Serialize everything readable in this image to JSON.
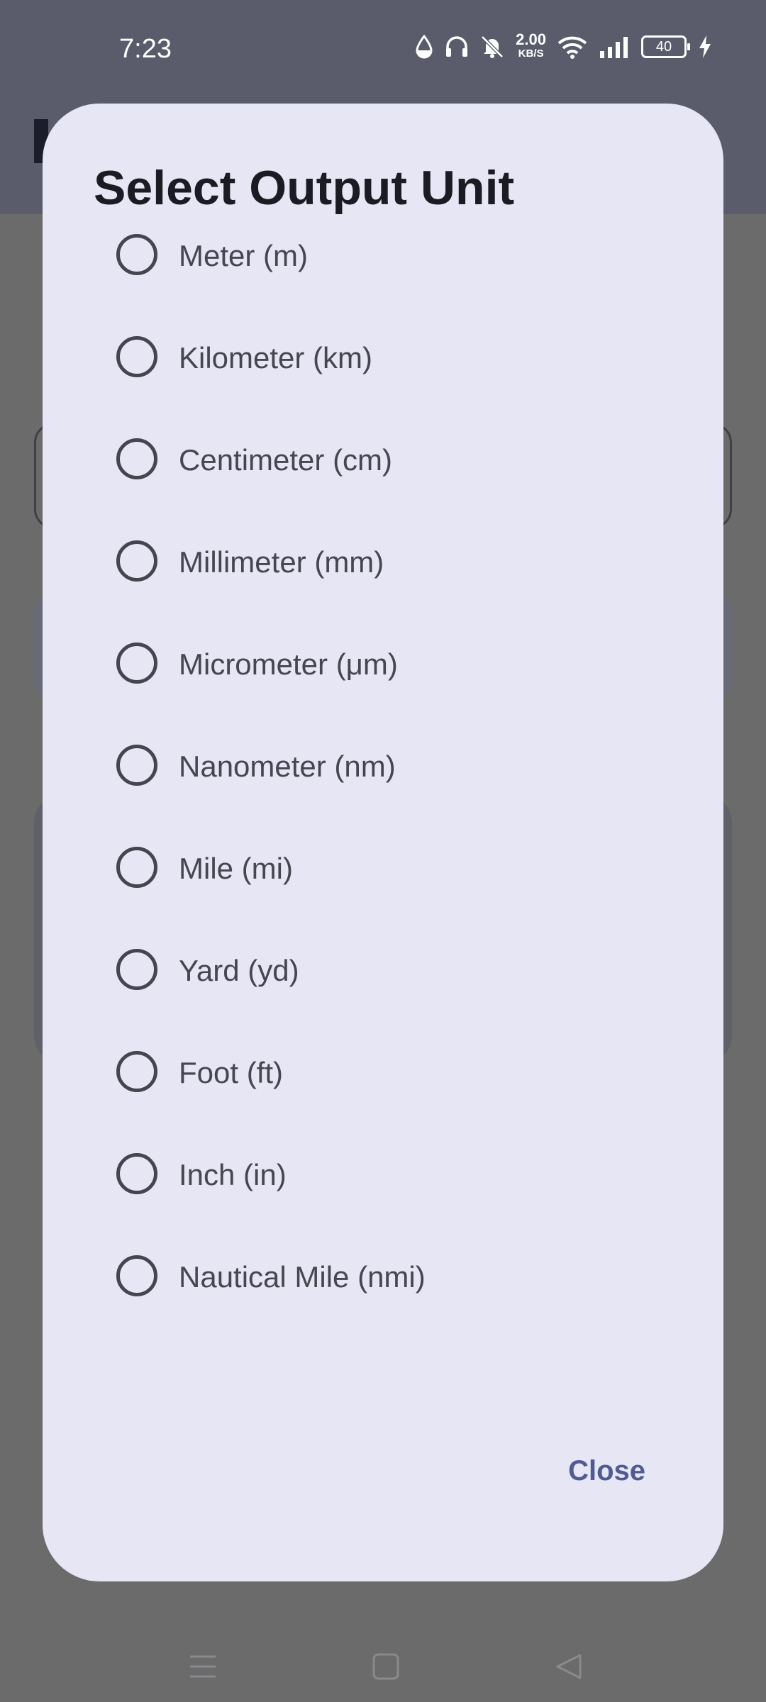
{
  "status_bar": {
    "time": "7:23",
    "net_speed_value": "2.00",
    "net_speed_unit": "KB/S",
    "battery": "40",
    "icons": [
      "drop-icon",
      "headphones-icon",
      "bell-off-icon",
      "wifi-icon",
      "signal-icon",
      "battery-icon",
      "charging-icon"
    ]
  },
  "dialog": {
    "title": "Select Output Unit",
    "options": [
      {
        "label": "Meter (m)",
        "selected": false
      },
      {
        "label": "Kilometer (km)",
        "selected": false
      },
      {
        "label": "Centimeter (cm)",
        "selected": false
      },
      {
        "label": "Millimeter (mm)",
        "selected": false
      },
      {
        "label": "Micrometer (μm)",
        "selected": false
      },
      {
        "label": "Nanometer (nm)",
        "selected": false
      },
      {
        "label": "Mile (mi)",
        "selected": false
      },
      {
        "label": "Yard (yd)",
        "selected": false
      },
      {
        "label": "Foot (ft)",
        "selected": false
      },
      {
        "label": "Inch (in)",
        "selected": false
      },
      {
        "label": "Nautical Mile (nmi)",
        "selected": false
      }
    ],
    "close_label": "Close"
  },
  "colors": {
    "dialog_bg": "#e6e6f4",
    "title": "#1b1b24",
    "radio": "#44454f",
    "accent": "#515b92",
    "scrim": "#6b6b6b"
  },
  "nav_bar": {
    "icons": [
      "menu-icon",
      "home-square-icon",
      "back-triangle-icon"
    ]
  }
}
